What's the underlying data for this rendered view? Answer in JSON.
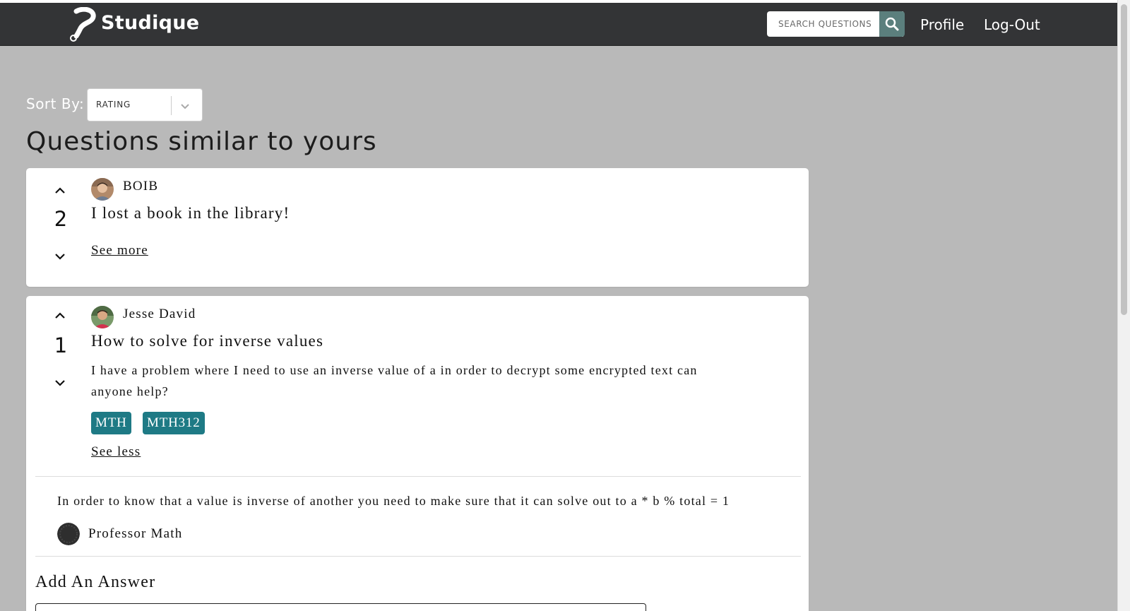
{
  "navbar": {
    "brand": "Studique",
    "search_placeholder": "SEARCH QUESTIONS",
    "profile_label": "Profile",
    "logout_label": "Log-Out"
  },
  "sort": {
    "label": "Sort By:",
    "selected": "RATING"
  },
  "page_title": "Questions similar to yours",
  "questions": [
    {
      "votes": "2",
      "author": "BOIB",
      "title": "I lost a book in the library!",
      "toggle_label": "See more"
    },
    {
      "votes": "1",
      "author": "Jesse David",
      "title": "How to solve for inverse values",
      "body": "I have a problem where I need to use an inverse value of a in order to decrypt some encrypted text can anyone help?",
      "tags": [
        "MTH",
        "MTH312"
      ],
      "toggle_label": "See less",
      "answers": [
        {
          "text": "In order to know that a value is inverse of another you need to make sure that it can solve out to a * b % total = 1",
          "author": "Professor Math"
        }
      ],
      "add_answer_title": "Add An Answer"
    }
  ],
  "colors": {
    "navbar_bg": "#333436",
    "page_bg": "#b9b9b9",
    "search_button": "#5b7f7d",
    "tag_bg": "#1e7a85"
  },
  "icons": {
    "logo": "question-mark-logo-icon",
    "search": "search-icon",
    "sort": "chevron-down-icon",
    "upvote": "chevron-up-icon",
    "downvote": "chevron-down-icon"
  }
}
